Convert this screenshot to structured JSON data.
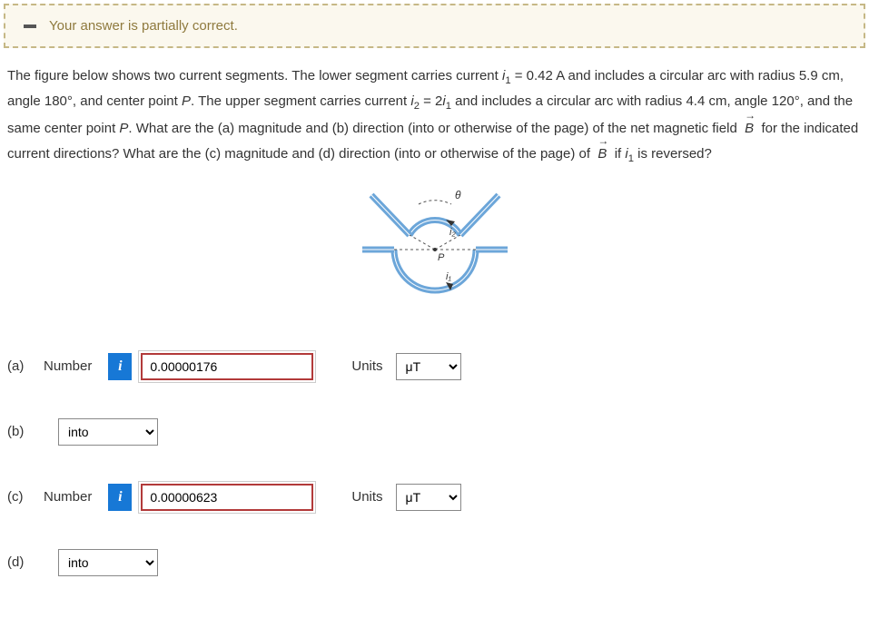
{
  "feedback": {
    "message": "Your answer is partially correct."
  },
  "question": {
    "p1_a": "The figure below shows two current segments. The lower segment carries current ",
    "i1_label": "i",
    "i1_sub": "1",
    "p1_b": " = 0.42 A and includes a circular arc with radius 5.9 cm, angle 180°, and center point ",
    "P1": "P",
    "p1_c": ". The upper segment carries current ",
    "i2_label": "i",
    "i2_sub": "2",
    "p1_d": " = 2",
    "i1b_label": "i",
    "i1b_sub": "1",
    "p1_e": " and includes a circular arc with radius 4.4 cm, angle 120°, and the same center point ",
    "P2": "P",
    "p1_f": ". What are the (a) magnitude and (b) direction (into or otherwise of the page) of the net magnetic field ",
    "B1": "B",
    "p1_g": " for the indicated current directions? What are the (c) magnitude and (d) direction (into or otherwise of the page) of ",
    "B2": "B",
    "p1_h": " if ",
    "i1c_label": "i",
    "i1c_sub": "1",
    "p1_i": " is reversed?"
  },
  "figure": {
    "theta": "θ",
    "i2": "i₂",
    "i1": "i₁",
    "P": "P"
  },
  "answers": {
    "a": {
      "part": "(a)",
      "label": "Number",
      "value": "0.00000176",
      "units_label": "Units",
      "unit": "μT"
    },
    "b": {
      "part": "(b)",
      "value": "into"
    },
    "c": {
      "part": "(c)",
      "label": "Number",
      "value": "0.00000623",
      "units_label": "Units",
      "unit": "μT"
    },
    "d": {
      "part": "(d)",
      "value": "into"
    }
  },
  "info_badge": "i"
}
